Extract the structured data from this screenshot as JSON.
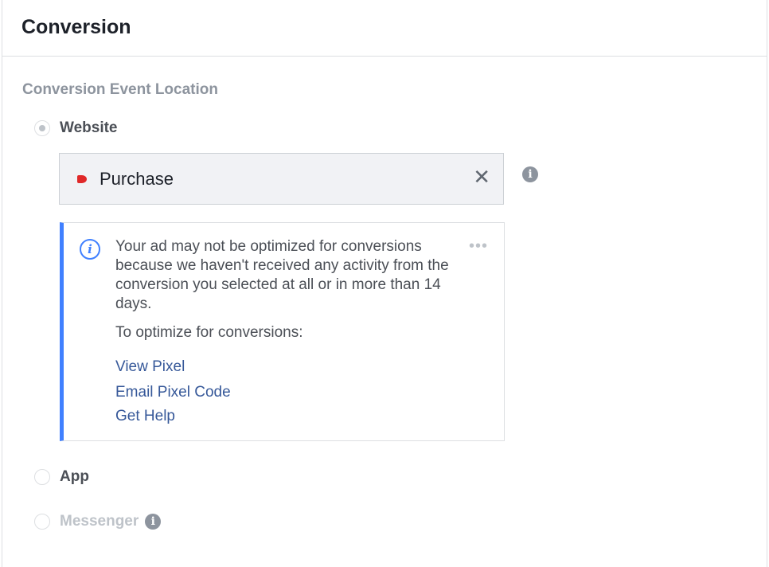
{
  "header": {
    "title": "Conversion"
  },
  "section": {
    "label": "Conversion Event Location"
  },
  "options": {
    "website": {
      "label": "Website"
    },
    "app": {
      "label": "App"
    },
    "messenger": {
      "label": "Messenger"
    }
  },
  "selector": {
    "value": "Purchase",
    "clear": "✕",
    "marker_color": "#e02828"
  },
  "notice": {
    "message": "Your ad may not be optimized for conversions because we haven't received any activity from the conversion you selected at all or in more than 14 days.",
    "subheading": "To optimize for conversions:",
    "links": {
      "view_pixel": "View Pixel",
      "email_pixel_code": "Email Pixel Code",
      "get_help": "Get Help"
    },
    "menu": "•••",
    "accent_color": "#4080ff"
  },
  "icons": {
    "info": "i"
  },
  "colors": {
    "link": "#365899",
    "muted": "#8d949e",
    "text": "#1d2129"
  }
}
